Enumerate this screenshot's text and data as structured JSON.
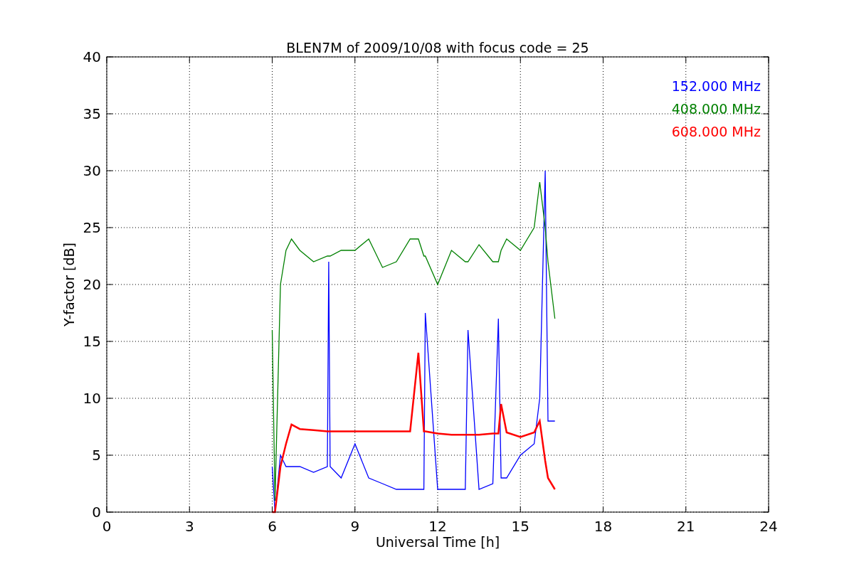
{
  "figure": {
    "chart_data": {
      "type": "line",
      "title": "BLEN7M of 2009/10/08 with focus code = 25",
      "xlabel": "Universal Time [h]",
      "ylabel": "Y-factor [dB]",
      "x": [
        6,
        6.1,
        6.3,
        6.5,
        6.7,
        7,
        7.5,
        8,
        8.05,
        8.1,
        8.5,
        9,
        9.5,
        10,
        10.5,
        11,
        11.3,
        11.5,
        11.55,
        12,
        12.5,
        13,
        13.1,
        13.5,
        14,
        14.2,
        14.3,
        14.5,
        15,
        15.5,
        15.7,
        15.9,
        16,
        16.25
      ],
      "series": [
        {
          "name": "152.000 MHz",
          "color": "#0000ff",
          "values": [
            4,
            0,
            5,
            4,
            4,
            4,
            3.5,
            4,
            22,
            4,
            3,
            6,
            3,
            2.5,
            2,
            2,
            2,
            2,
            17.5,
            2,
            2,
            2,
            16,
            2,
            2.5,
            17,
            3,
            3,
            5,
            6,
            10,
            30,
            8,
            8
          ]
        },
        {
          "name": "408.000 MHz",
          "color": "#008000",
          "values": [
            16,
            1,
            20,
            23,
            24,
            23,
            22,
            22.5,
            22.5,
            22.5,
            23,
            23,
            24,
            21.5,
            22,
            24,
            24,
            22.5,
            22.5,
            20,
            23,
            22,
            22,
            23.5,
            22,
            22,
            23,
            24,
            23,
            25,
            29,
            25,
            22,
            17
          ]
        },
        {
          "name": "608.000 MHz",
          "color": "#ff0000",
          "values": [
            0,
            0,
            4,
            6,
            7.7,
            7.3,
            7.2,
            7.1,
            7.1,
            7.1,
            7.1,
            7.1,
            7.1,
            7.1,
            7.1,
            7.1,
            14,
            7.1,
            7.1,
            6.9,
            6.8,
            6.8,
            6.8,
            6.8,
            6.9,
            6.9,
            9.5,
            7,
            6.6,
            7,
            8,
            4.5,
            3,
            2
          ]
        }
      ],
      "xlim": [
        0,
        24
      ],
      "ylim": [
        0,
        40
      ],
      "xticks": [
        0,
        3,
        6,
        9,
        12,
        15,
        18,
        21,
        24
      ],
      "yticks": [
        0,
        5,
        10,
        15,
        20,
        25,
        30,
        35,
        40
      ],
      "grid": true
    }
  }
}
